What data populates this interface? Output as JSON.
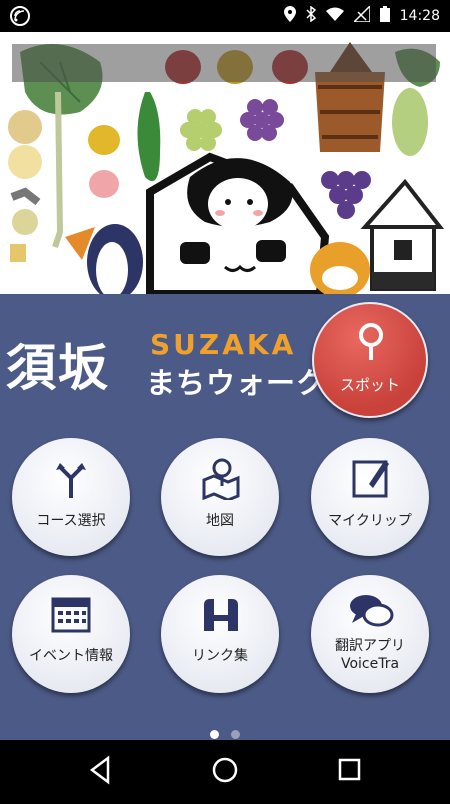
{
  "status_bar": {
    "time": "14:28"
  },
  "logo": {
    "kanji": "須坂",
    "roman": "SUZAKA",
    "subtitle": "まちウォーク"
  },
  "spot_button": {
    "label": "スポット"
  },
  "menu": {
    "course": "コース選択",
    "map": "地図",
    "myclip": "マイクリップ",
    "event": "イベント情報",
    "links": "リンク集",
    "translate_line1": "翻訳アプリ",
    "translate_line2": "VoiceTra"
  },
  "pager": {
    "pages": 2,
    "current": 1
  },
  "colors": {
    "main_bg": "#4c5a87",
    "accent_orange": "#f0a12b",
    "spot_red": "#c8413a"
  }
}
